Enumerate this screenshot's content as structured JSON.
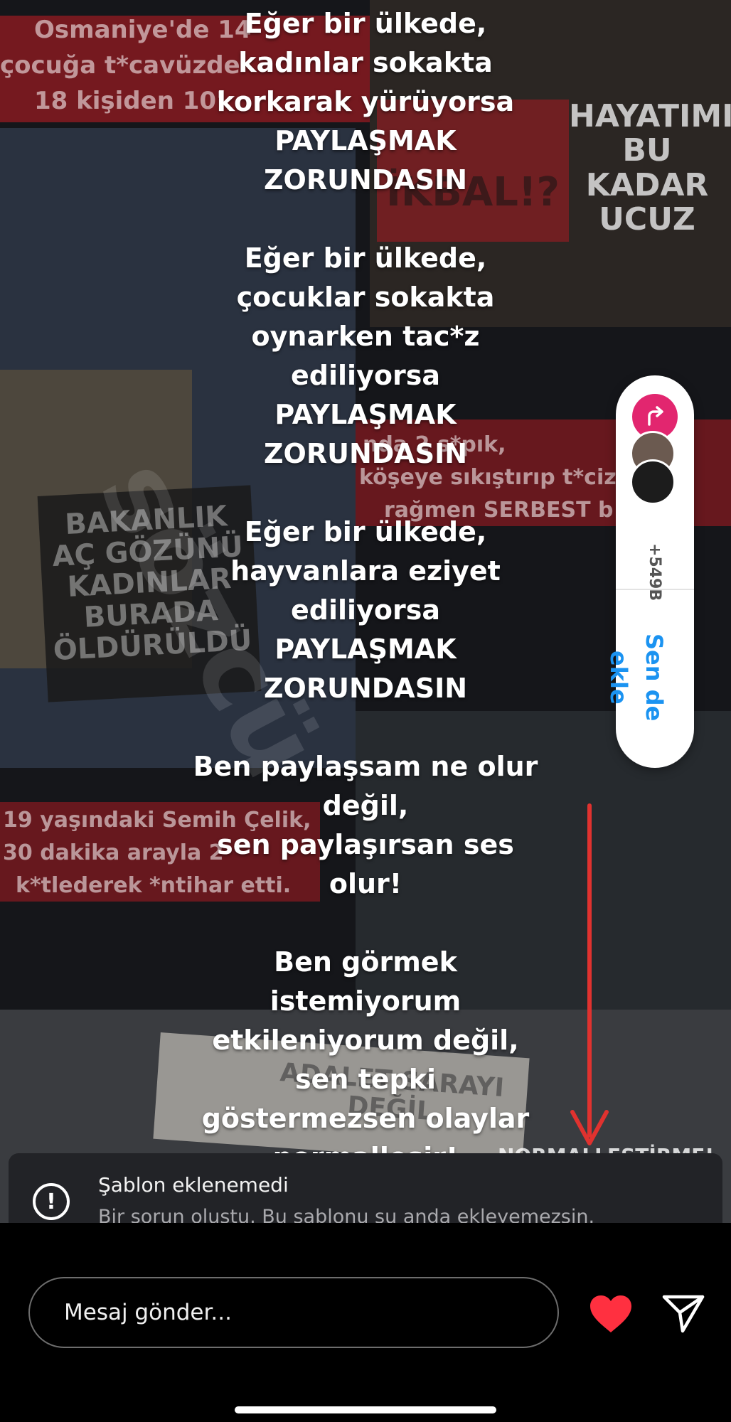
{
  "story": {
    "main_text": "Eğer bir ülkede,\nkadınlar sokakta\nkorkarak yürüyorsa\nPAYLAŞMAK\nZORUNDASIN\n\nEğer bir ülkede,\nçocuklar sokakta\noynarken tac*z\nediliyorsa\nPAYLAŞMAK\nZORUNDASIN\n\nEğer bir ülkede,\nhayvanlara eziyet\nediliyorsa\nPAYLAŞMAK\nZORUNDASIN\n\nBen paylaşsam ne olur\ndeğil,\nsen paylaşırsan ses\nolur!\n\nBen görmek\nistemiyorum\netkileniyorum değil,\nsen tepki\ngöstermezsen olaylar\nnormalleşir!",
    "background_fragments": {
      "top_left_1": "Osmaniye'de 14",
      "top_left_2": "çocuğa t*cavüzde",
      "top_left_3": "18 kişiden 10'",
      "sign_top_right": "HAYATIMIZ\nBU KADAR\nUCUZ",
      "sign_ikbal": "İKBAL!?",
      "right_mid_1": "nda 2 s*pık,",
      "right_mid_2": "köşeye sıkıştırıp t*ciz e",
      "right_mid_3": "rağmen SERBEST b",
      "sign_left": "BAKANLIK\nAÇ GÖZÜNÜ\nKADINLAR\nBURADA\nÖLDÜRÜLDÜ",
      "left_mid_1": "19 yaşındaki Semih Çelik,",
      "left_mid_2": "30 dakika arayla 2",
      "left_mid_3": "k*tlederek *ntihar etti.",
      "bottom_sign": "ADALET SARAYI DEĞİL",
      "bottom_right": "NORMALLEŞTİRME!",
      "watermark": "sözcü"
    },
    "accent_red": "#9e1b22",
    "arrow_color": "#e0322f"
  },
  "sticker": {
    "count": "+549B",
    "add_label": "Sen de ekle",
    "icon": "reshare-arrow-icon",
    "accent": "#e2266f",
    "label_color": "#1b93f1"
  },
  "toast": {
    "icon": "exclamation-circle-icon",
    "title": "Şablon eklenemedi",
    "message": "Bir sorun oluştu. Bu şablonu şu anda ekleyemezsin."
  },
  "composer": {
    "placeholder": "Mesaj gönder...",
    "like_icon": "heart-icon",
    "like_color": "#ff3040",
    "send_icon": "send-icon"
  }
}
